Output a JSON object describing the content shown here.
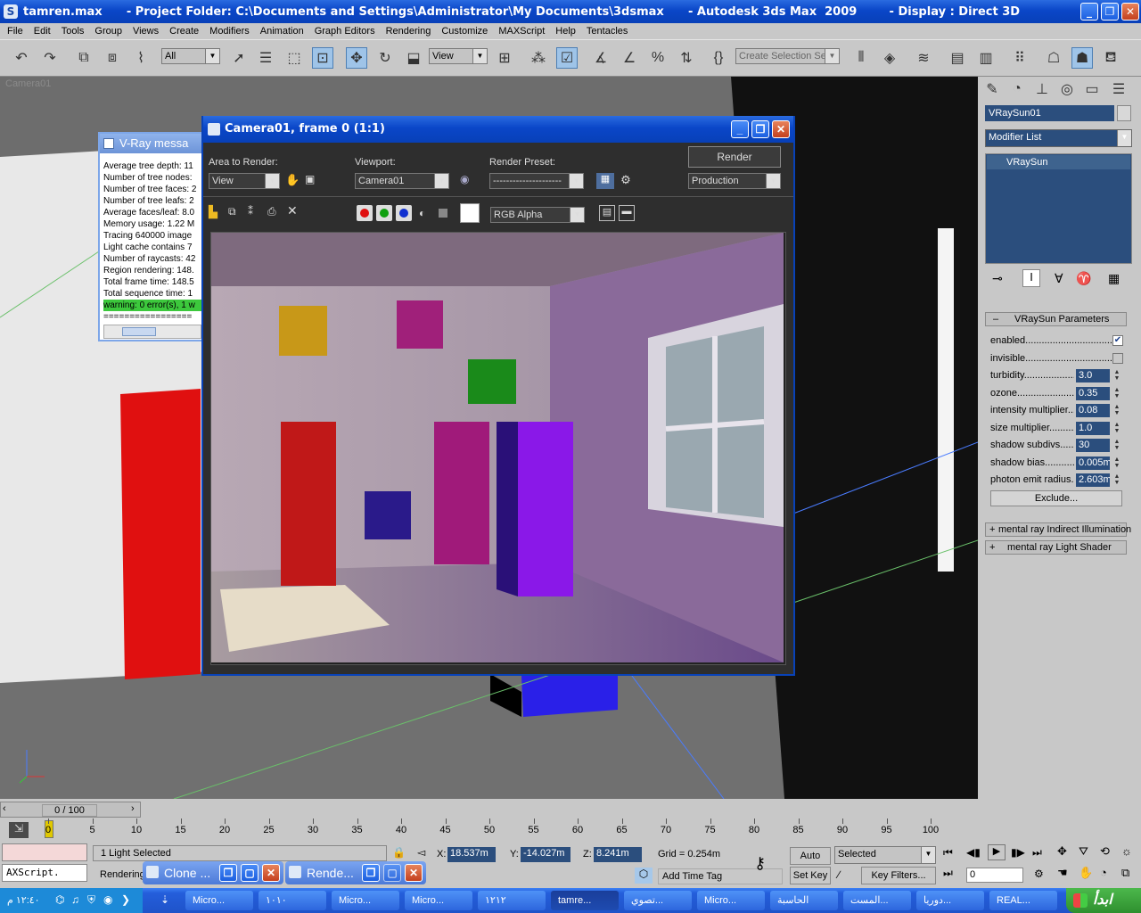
{
  "app": {
    "title": "tamren.max      - Project Folder: C:\\Documents and Settings\\Administrator\\My Documents\\3dsmax      - Autodesk 3ds Max  2009        - Display : Direct 3D"
  },
  "menu": [
    "File",
    "Edit",
    "Tools",
    "Group",
    "Views",
    "Create",
    "Modifiers",
    "Animation",
    "Graph Editors",
    "Rendering",
    "Customize",
    "MAXScript",
    "Help",
    "Tentacles"
  ],
  "toolbar": {
    "selection_filter": "All",
    "ref_coord": "View",
    "named_selection_placeholder": "Create Selection Set"
  },
  "viewport": {
    "label": "Camera01"
  },
  "vray_messages": {
    "title": "V-Ray messa",
    "lines": [
      "Average tree depth: 11",
      "Number of tree nodes:",
      "Number of tree faces: 2",
      "Number of tree leafs: 2",
      "Average faces/leaf: 8.0",
      "Memory usage: 1.22 M",
      "Tracing 640000 image",
      "Light cache contains 7",
      "Number of raycasts: 42",
      "Region rendering: 148.",
      "Total frame time: 148.5",
      "Total sequence time: 1"
    ],
    "warning": "warning: 0 error(s), 1 w",
    "rule": "================="
  },
  "render_window": {
    "title": "Camera01, frame 0 (1:1)",
    "area_label": "Area to Render:",
    "area_value": "View",
    "viewport_label": "Viewport:",
    "viewport_value": "Camera01",
    "preset_label": "Render Preset:",
    "preset_value": "---------------------",
    "render_button": "Render",
    "production_value": "Production",
    "channel_value": "RGB Alpha"
  },
  "command_panel": {
    "object_name": "VRaySun01",
    "modifier_list": "Modifier List",
    "stack_item": "VRaySun",
    "rollout_title": "VRaySun Parameters",
    "params": [
      {
        "label": "enabled....................................",
        "checked": true
      },
      {
        "label": "invisible....................................",
        "checked": false
      },
      {
        "label": "turbidity.....................",
        "value": "3.0"
      },
      {
        "label": "ozone...........................",
        "value": "0.35"
      },
      {
        "label": "intensity multiplier.....",
        "value": "0.08"
      },
      {
        "label": "size multiplier.............",
        "value": "1.0"
      },
      {
        "label": "shadow subdivs.........",
        "value": "30"
      },
      {
        "label": "shadow bias...............",
        "value": "0.005m"
      },
      {
        "label": "photon emit radius....",
        "value": "2.603m"
      }
    ],
    "exclude_button": "Exclude...",
    "rollouts": [
      "mental ray Indirect Illumination",
      "mental ray Light Shader"
    ]
  },
  "timeline": {
    "frame_counter": "0 / 100",
    "ticks": [
      "0",
      "5",
      "10",
      "15",
      "20",
      "25",
      "30",
      "35",
      "40",
      "45",
      "50",
      "55",
      "60",
      "65",
      "70",
      "75",
      "80",
      "85",
      "90",
      "95",
      "100"
    ]
  },
  "status": {
    "maxscript": "AXScript.",
    "selection_text": "1 Light Selected",
    "prompt_text": "Rendering",
    "x_value": "18.537m",
    "y_value": "-14.027m",
    "z_value": "8.241m",
    "grid_text": "Grid = 0.254m",
    "add_time_tag": "Add Time Tag",
    "auto_key": "Auto Key",
    "set_key": "Set Key",
    "key_mode": "Selected",
    "key_filters": "Key Filters...",
    "frame_field": "0",
    "x_label": "X:",
    "y_label": "Y:",
    "z_label": "Z:"
  },
  "floating_windows": [
    {
      "label": "Clone ..."
    },
    {
      "label": "Rende..."
    }
  ],
  "taskbar": {
    "clock": "١٢:٤٠ م",
    "items": [
      "Micro...",
      "١٠١٠",
      "Micro...",
      "Micro...",
      "١٢١٢",
      "tamre...",
      "تصوي...",
      "Micro...",
      "الحاسبة",
      "المست...",
      "دوريا...",
      "REAL..."
    ],
    "start_label": "ابدأ"
  }
}
